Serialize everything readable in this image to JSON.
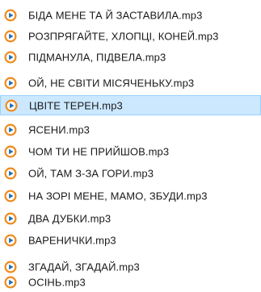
{
  "files": [
    {
      "name": "БІДА МЕНЕ ТА Й ЗАСТАВИЛА.mp3",
      "selected": false
    },
    {
      "name": "РОЗПРЯГАЙТЕ, ХЛОПЦІ, КОНЕЙ.mp3",
      "selected": false
    },
    {
      "name": "ПІДМАНУЛА, ПІДВЕЛА.mp3",
      "selected": false
    },
    {
      "name": "ОЙ, НЕ СВІТИ МІСЯЧЕНЬКУ.mp3",
      "selected": false
    },
    {
      "name": "ЦВІТЕ ТЕРЕН.mp3",
      "selected": true
    },
    {
      "name": "ЯСЕНИ.mp3",
      "selected": false
    },
    {
      "name": "ЧОМ ТИ НЕ ПРИЙШОВ.mp3",
      "selected": false
    },
    {
      "name": "ОЙ, ТАМ З-ЗА ГОРИ.mp3",
      "selected": false
    },
    {
      "name": "НА ЗОРІ МЕНЕ, МАМО, ЗБУДИ.mp3",
      "selected": false
    },
    {
      "name": "ДВА ДУБКИ.mp3",
      "selected": false
    },
    {
      "name": "ВАРЕНИЧКИ.mp3",
      "selected": false
    },
    {
      "name": "ЗГАДАЙ, ЗГАДАЙ.mp3",
      "selected": false
    },
    {
      "name": "ОСІНЬ.mp3",
      "selected": false
    }
  ],
  "icon": "media-player-file-icon",
  "colors": {
    "selection_background": "#cce8ff",
    "selection_border": "#99d1ff",
    "icon_orange": "#f08a1c",
    "icon_blue": "#1f6fb5"
  }
}
